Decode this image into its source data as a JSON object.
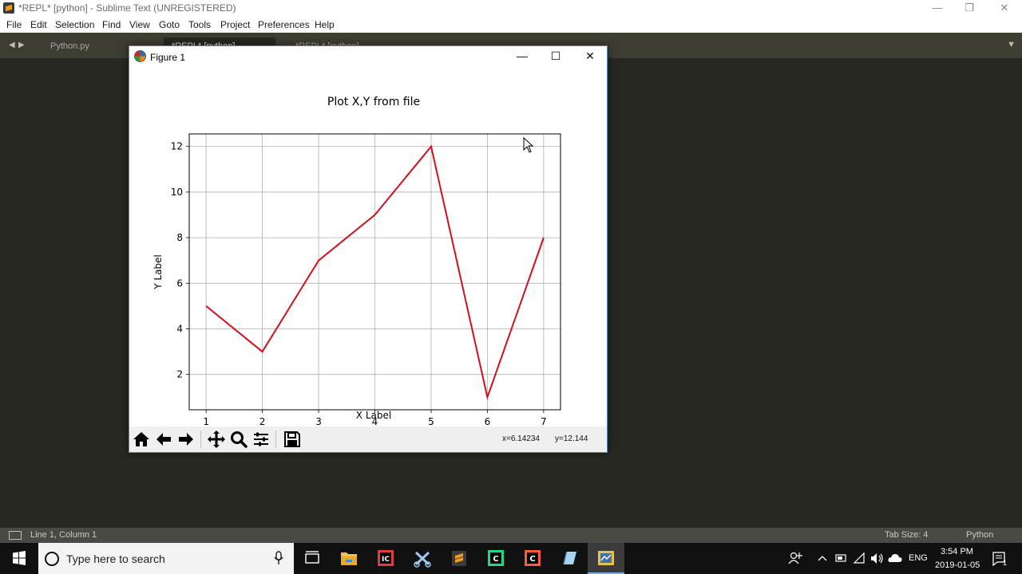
{
  "sublime": {
    "title": "*REPL* [python] - Sublime Text (UNREGISTERED)",
    "menu": [
      "File",
      "Edit",
      "Selection",
      "Find",
      "View",
      "Goto",
      "Tools",
      "Project",
      "Preferences",
      "Help"
    ],
    "tabs": [
      {
        "label": "Python.py",
        "active": false
      },
      {
        "label": "*REPL* [python]",
        "active": true
      },
      {
        "label": "*REPL* [python]",
        "active": false
      }
    ],
    "status": {
      "position": "Line 1, Column 1",
      "tab_size": "Tab Size: 4",
      "syntax": "Python"
    }
  },
  "figure": {
    "window_title": "Figure 1",
    "coords": {
      "x": "x=6.14234",
      "y": "y=12.144"
    },
    "toolbar": [
      "home-icon",
      "back-arrow-icon",
      "forward-arrow-icon",
      "pan-icon",
      "zoom-icon",
      "configure-subplots-icon",
      "save-icon"
    ]
  },
  "chart_data": {
    "type": "line",
    "title": "Plot X,Y from file",
    "xlabel": "X Label",
    "ylabel": "Y Label",
    "x": [
      1,
      2,
      3,
      4,
      5,
      6,
      7
    ],
    "series": [
      {
        "values": [
          5,
          3,
          7,
          9,
          12,
          1,
          8
        ],
        "color": "#d0101a"
      }
    ],
    "xticks": [
      "1",
      "2",
      "3",
      "4",
      "5",
      "6",
      "7"
    ],
    "yticks": [
      "2",
      "4",
      "6",
      "8",
      "10",
      "12"
    ],
    "xlim": [
      0.7,
      7.3
    ],
    "ylim": [
      0.45,
      12.55
    ],
    "grid": true
  },
  "taskbar": {
    "search_placeholder": "Type here to search",
    "apps": [
      "task-view-icon",
      "file-explorer-icon",
      "intellij-icon",
      "snipping-tool-icon",
      "sublime-text-icon",
      "pycharm-icon",
      "intellij-community-icon",
      "notepad-icon",
      "python-figure-icon"
    ],
    "language": "ENG",
    "time": "3:54 PM",
    "date": "2019-01-05",
    "notifications": "1"
  }
}
